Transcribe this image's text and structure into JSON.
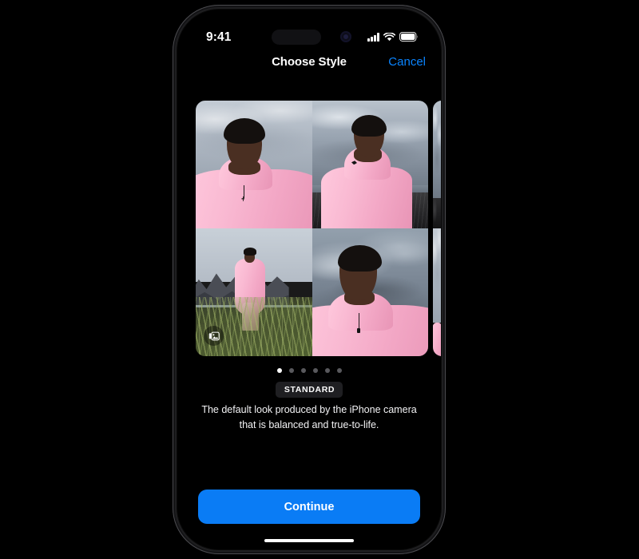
{
  "status_bar": {
    "time": "9:41",
    "signal_icon": "cellular-signal-icon",
    "wifi_icon": "wifi-icon",
    "battery_icon": "battery-icon",
    "dynamic_island": "dynamic-island",
    "front_camera": "front-camera-dot"
  },
  "nav_bar": {
    "title": "Choose Style",
    "cancel_label": "Cancel"
  },
  "carousel": {
    "gallery_badge_icon": "photo-stack-icon",
    "photos": [
      {
        "position": "top-left",
        "description": "Portrait selfie of man in pink jacket with mountains and cloudy sky"
      },
      {
        "position": "top-right",
        "description": "Man in pink jacket standing on black sand beach under overcast sky"
      },
      {
        "position": "bottom-left",
        "description": "Full body shot of man in pink outfit on grassy hill with mountains and water"
      },
      {
        "position": "bottom-right",
        "description": "Close-up portrait of man in pink jacket against dark stormy sky"
      }
    ],
    "page_count": 6,
    "active_page": 1
  },
  "style": {
    "name": "STANDARD",
    "description": "The default look produced by the iPhone camera that is balanced and true-to-life."
  },
  "footer": {
    "continue_label": "Continue",
    "home_indicator": "home-indicator"
  },
  "colors": {
    "accent_blue": "#0a7cf5",
    "link_blue": "#0a84ff",
    "screen_background": "#000000",
    "badge_background": "#1f1f22",
    "dot_inactive": "#59595d",
    "dot_active": "#ffffff"
  }
}
